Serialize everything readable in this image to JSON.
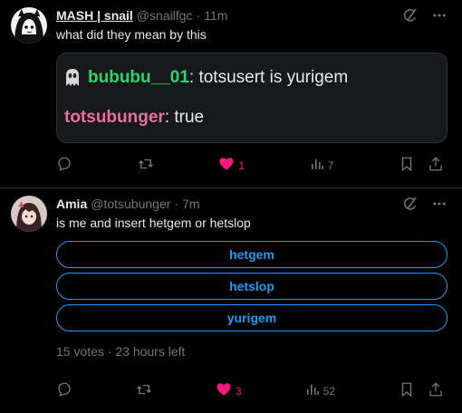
{
  "tweet1": {
    "name": "MASH | snail",
    "handle": "@snailfgc",
    "dot": "·",
    "time": "11m",
    "text": "what did they mean by this",
    "quote": {
      "line1_user": "bububu__01",
      "line1_text": ": totsusert is yurigem",
      "line2_user": "totsubunger",
      "line2_text": ": true"
    },
    "stats": {
      "replies": "",
      "reposts": "",
      "likes": "1",
      "views": "7"
    }
  },
  "tweet2": {
    "name": "Amia",
    "handle": "@totsubunger",
    "dot": "·",
    "time": "7m",
    "text": "is me and insert hetgem or hetslop",
    "poll": {
      "options": [
        "hetgem",
        "hetslop",
        "yurigem"
      ],
      "meta": "15 votes · 23 hours left"
    },
    "stats": {
      "replies": "",
      "reposts": "",
      "likes": "3",
      "views": "52"
    }
  },
  "colors": {
    "background": "#000000",
    "text": "#e7e9ea",
    "muted": "#71767b",
    "accent": "#1d9bf0",
    "like": "#f91880",
    "quote_green": "#27d76a",
    "quote_pink": "#e8719b"
  },
  "icons": [
    "grok-icon",
    "more-icon",
    "reply-icon",
    "repost-icon",
    "heart-icon",
    "views-icon",
    "bookmark-icon",
    "share-icon"
  ]
}
